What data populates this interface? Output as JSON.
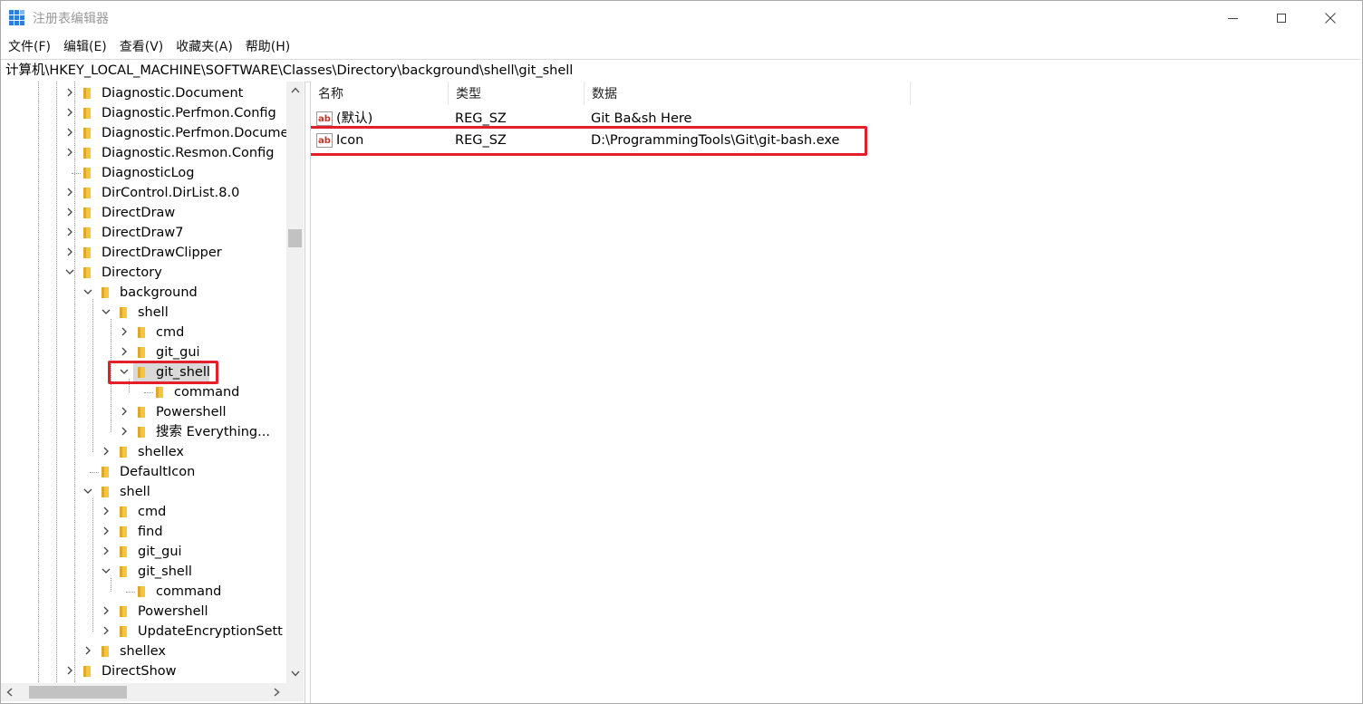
{
  "window": {
    "title": "注册表编辑器",
    "controls": {
      "minimize": "minimize",
      "maximize": "maximize",
      "close": "close"
    }
  },
  "menu": [
    "文件(F)",
    "编辑(E)",
    "查看(V)",
    "收藏夹(A)",
    "帮助(H)"
  ],
  "address": "计算机\\HKEY_LOCAL_MACHINE\\SOFTWARE\\Classes\\Directory\\background\\shell\\git_shell",
  "tree": [
    {
      "label": "Diagnostic.Document",
      "depth": 0,
      "state": "collapsed"
    },
    {
      "label": "Diagnostic.Perfmon.Config",
      "depth": 0,
      "state": "collapsed"
    },
    {
      "label": "Diagnostic.Perfmon.Docume",
      "depth": 0,
      "state": "collapsed"
    },
    {
      "label": "Diagnostic.Resmon.Config",
      "depth": 0,
      "state": "collapsed"
    },
    {
      "label": "DiagnosticLog",
      "depth": 0,
      "state": "leaf"
    },
    {
      "label": "DirControl.DirList.8.0",
      "depth": 0,
      "state": "collapsed"
    },
    {
      "label": "DirectDraw",
      "depth": 0,
      "state": "collapsed"
    },
    {
      "label": "DirectDraw7",
      "depth": 0,
      "state": "collapsed"
    },
    {
      "label": "DirectDrawClipper",
      "depth": 0,
      "state": "collapsed"
    },
    {
      "label": "Directory",
      "depth": 0,
      "state": "expanded"
    },
    {
      "label": "background",
      "depth": 1,
      "state": "expanded"
    },
    {
      "label": "shell",
      "depth": 2,
      "state": "expanded"
    },
    {
      "label": "cmd",
      "depth": 3,
      "state": "collapsed"
    },
    {
      "label": "git_gui",
      "depth": 3,
      "state": "collapsed"
    },
    {
      "label": "git_shell",
      "depth": 3,
      "state": "expanded",
      "selected": true,
      "highlighted": true
    },
    {
      "label": "command",
      "depth": 4,
      "state": "leaf"
    },
    {
      "label": "Powershell",
      "depth": 3,
      "state": "collapsed"
    },
    {
      "label": "搜索 Everything...",
      "depth": 3,
      "state": "collapsed"
    },
    {
      "label": "shellex",
      "depth": 2,
      "state": "collapsed"
    },
    {
      "label": "DefaultIcon",
      "depth": 1,
      "state": "leaf"
    },
    {
      "label": "shell",
      "depth": 1,
      "state": "expanded"
    },
    {
      "label": "cmd",
      "depth": 2,
      "state": "collapsed"
    },
    {
      "label": "find",
      "depth": 2,
      "state": "collapsed"
    },
    {
      "label": "git_gui",
      "depth": 2,
      "state": "collapsed"
    },
    {
      "label": "git_shell",
      "depth": 2,
      "state": "expanded"
    },
    {
      "label": "command",
      "depth": 3,
      "state": "leaf"
    },
    {
      "label": "Powershell",
      "depth": 2,
      "state": "collapsed"
    },
    {
      "label": "UpdateEncryptionSett",
      "depth": 2,
      "state": "collapsed"
    },
    {
      "label": "shellex",
      "depth": 1,
      "state": "collapsed"
    },
    {
      "label": "DirectShow",
      "depth": 0,
      "state": "collapsed"
    }
  ],
  "list": {
    "headers": {
      "name": "名称",
      "type": "类型",
      "data": "数据"
    },
    "rows": [
      {
        "name": "(默认)",
        "type": "REG_SZ",
        "data": "Git Ba&sh Here",
        "highlighted": false
      },
      {
        "name": "Icon",
        "type": "REG_SZ",
        "data": "D:\\ProgrammingTools\\Git\\git-bash.exe",
        "highlighted": true
      }
    ]
  },
  "colors": {
    "highlight_box": "#e3202a",
    "folder": "#f5c542",
    "selection": "#d9d9d9",
    "reg_sz_icon": "#c0392b"
  },
  "scroll": {
    "tree_vertical_position": 0.24,
    "tree_horizontal_position": 0.0
  }
}
